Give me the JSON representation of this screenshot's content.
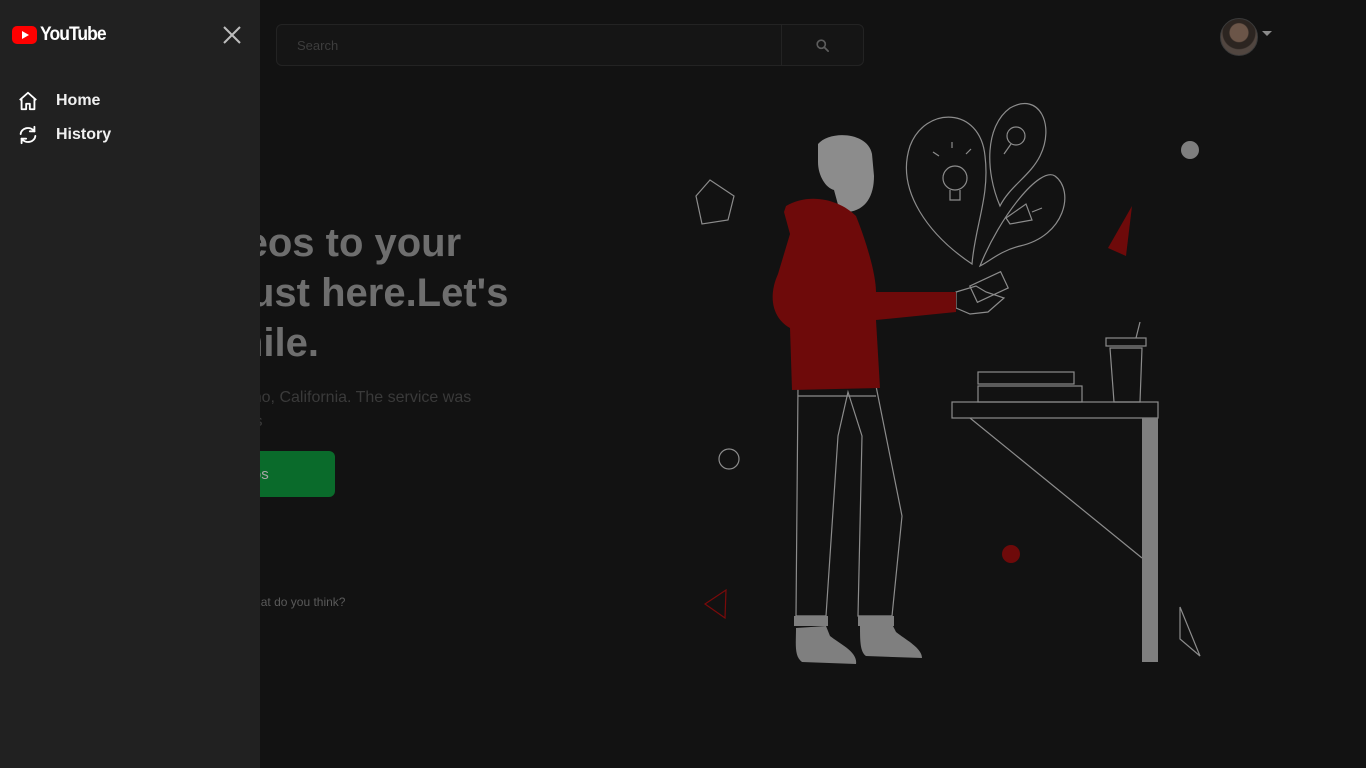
{
  "header": {
    "search_placeholder": "Search"
  },
  "sidebar": {
    "logo_text": "YouTube",
    "items": [
      {
        "label": "Home",
        "icon": "home-icon"
      },
      {
        "label": "History",
        "icon": "history-icon"
      }
    ]
  },
  "hero": {
    "title_line1": "he videos to your",
    "title_line2": "d not just here.Let's",
    "title_line3": "our smile.",
    "desc_line1": " based in San Bruno, California. The service was",
    "desc_line2": " PayPal employees",
    "cta_label": "deos",
    "footer_text": "enge page redesign. What do you think?"
  },
  "colors": {
    "accent": "#ff0000",
    "sidebar_bg": "#212121",
    "page_bg": "#121212",
    "cta_bg": "#0a6b2b",
    "illustration_red": "#7a0a0a"
  }
}
